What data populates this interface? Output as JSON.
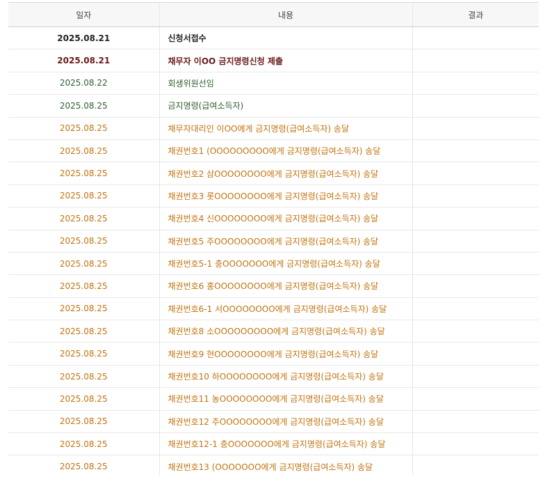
{
  "headers": {
    "date": "일자",
    "content": "내용",
    "result": "결과"
  },
  "rows": [
    {
      "date": "2025.08.21",
      "content": "신청서접수",
      "result": "",
      "style": "black"
    },
    {
      "date": "2025.08.21",
      "content": "채무자 이OO 금지명령신청 제출",
      "result": "",
      "style": "maroon"
    },
    {
      "date": "2025.08.22",
      "content": "회생위원선임",
      "result": "",
      "style": "green"
    },
    {
      "date": "2025.08.25",
      "content": "금지명령(급여소득자)",
      "result": "",
      "style": "green"
    },
    {
      "date": "2025.08.25",
      "content": "채무자대리인 이OO에게 금지명령(급여소득자) 송달",
      "result": "",
      "style": "orange"
    },
    {
      "date": "2025.08.25",
      "content": "채권번호1 (OOOOOOOOO에게 금지명령(급여소득자) 송달",
      "result": "",
      "style": "orange"
    },
    {
      "date": "2025.08.25",
      "content": "채권번호2 삼OOOOOOOO에게 금지명령(급여소득자) 송달",
      "result": "",
      "style": "orange"
    },
    {
      "date": "2025.08.25",
      "content": "채권번호3 롯OOOOOOOO에게 금지명령(급여소득자) 송달",
      "result": "",
      "style": "orange"
    },
    {
      "date": "2025.08.25",
      "content": "채권번호4 신OOOOOOOO에게 금지명령(급여소득자) 송달",
      "result": "",
      "style": "orange"
    },
    {
      "date": "2025.08.25",
      "content": "채권번호5 주OOOOOOOO에게 금지명령(급여소득자) 송달",
      "result": "",
      "style": "orange"
    },
    {
      "date": "2025.08.25",
      "content": "채권번호5-1 충OOOOOOO에게 금지명령(급여소득자) 송달",
      "result": "",
      "style": "orange"
    },
    {
      "date": "2025.08.25",
      "content": "채권번호6 홍OOOOOOOO에게 금지명령(급여소득자) 송달",
      "result": "",
      "style": "orange"
    },
    {
      "date": "2025.08.25",
      "content": "채권번호6-1 서OOOOOOOO에게 금지명령(급여소득자) 송달",
      "result": "",
      "style": "orange"
    },
    {
      "date": "2025.08.25",
      "content": "채권번호8 소OOOOOOOOO에게 금지명령(급여소득자) 송달",
      "result": "",
      "style": "orange"
    },
    {
      "date": "2025.08.25",
      "content": "채권번호9 현OOOOOOOO에게 금지명령(급여소득자) 송달",
      "result": "",
      "style": "orange"
    },
    {
      "date": "2025.08.25",
      "content": "채권번호10 하OOOOOOOO에게 금지명령(급여소득자) 송달",
      "result": "",
      "style": "orange"
    },
    {
      "date": "2025.08.25",
      "content": "채권번호11 농OOOOOOOO에게 금지명령(급여소득자) 송달",
      "result": "",
      "style": "orange"
    },
    {
      "date": "2025.08.25",
      "content": "채권번호12 주OOOOOOOO에게 금지명령(급여소득자) 송달",
      "result": "",
      "style": "orange"
    },
    {
      "date": "2025.08.25",
      "content": "채권번호12-1 충OOOOOOO에게 금지명령(급여소득자) 송달",
      "result": "",
      "style": "orange"
    },
    {
      "date": "2025.08.25",
      "content": "채권번호13 (OOOOOOO에게 금지명령(급여소득자) 송달",
      "result": "",
      "style": "orange"
    }
  ]
}
